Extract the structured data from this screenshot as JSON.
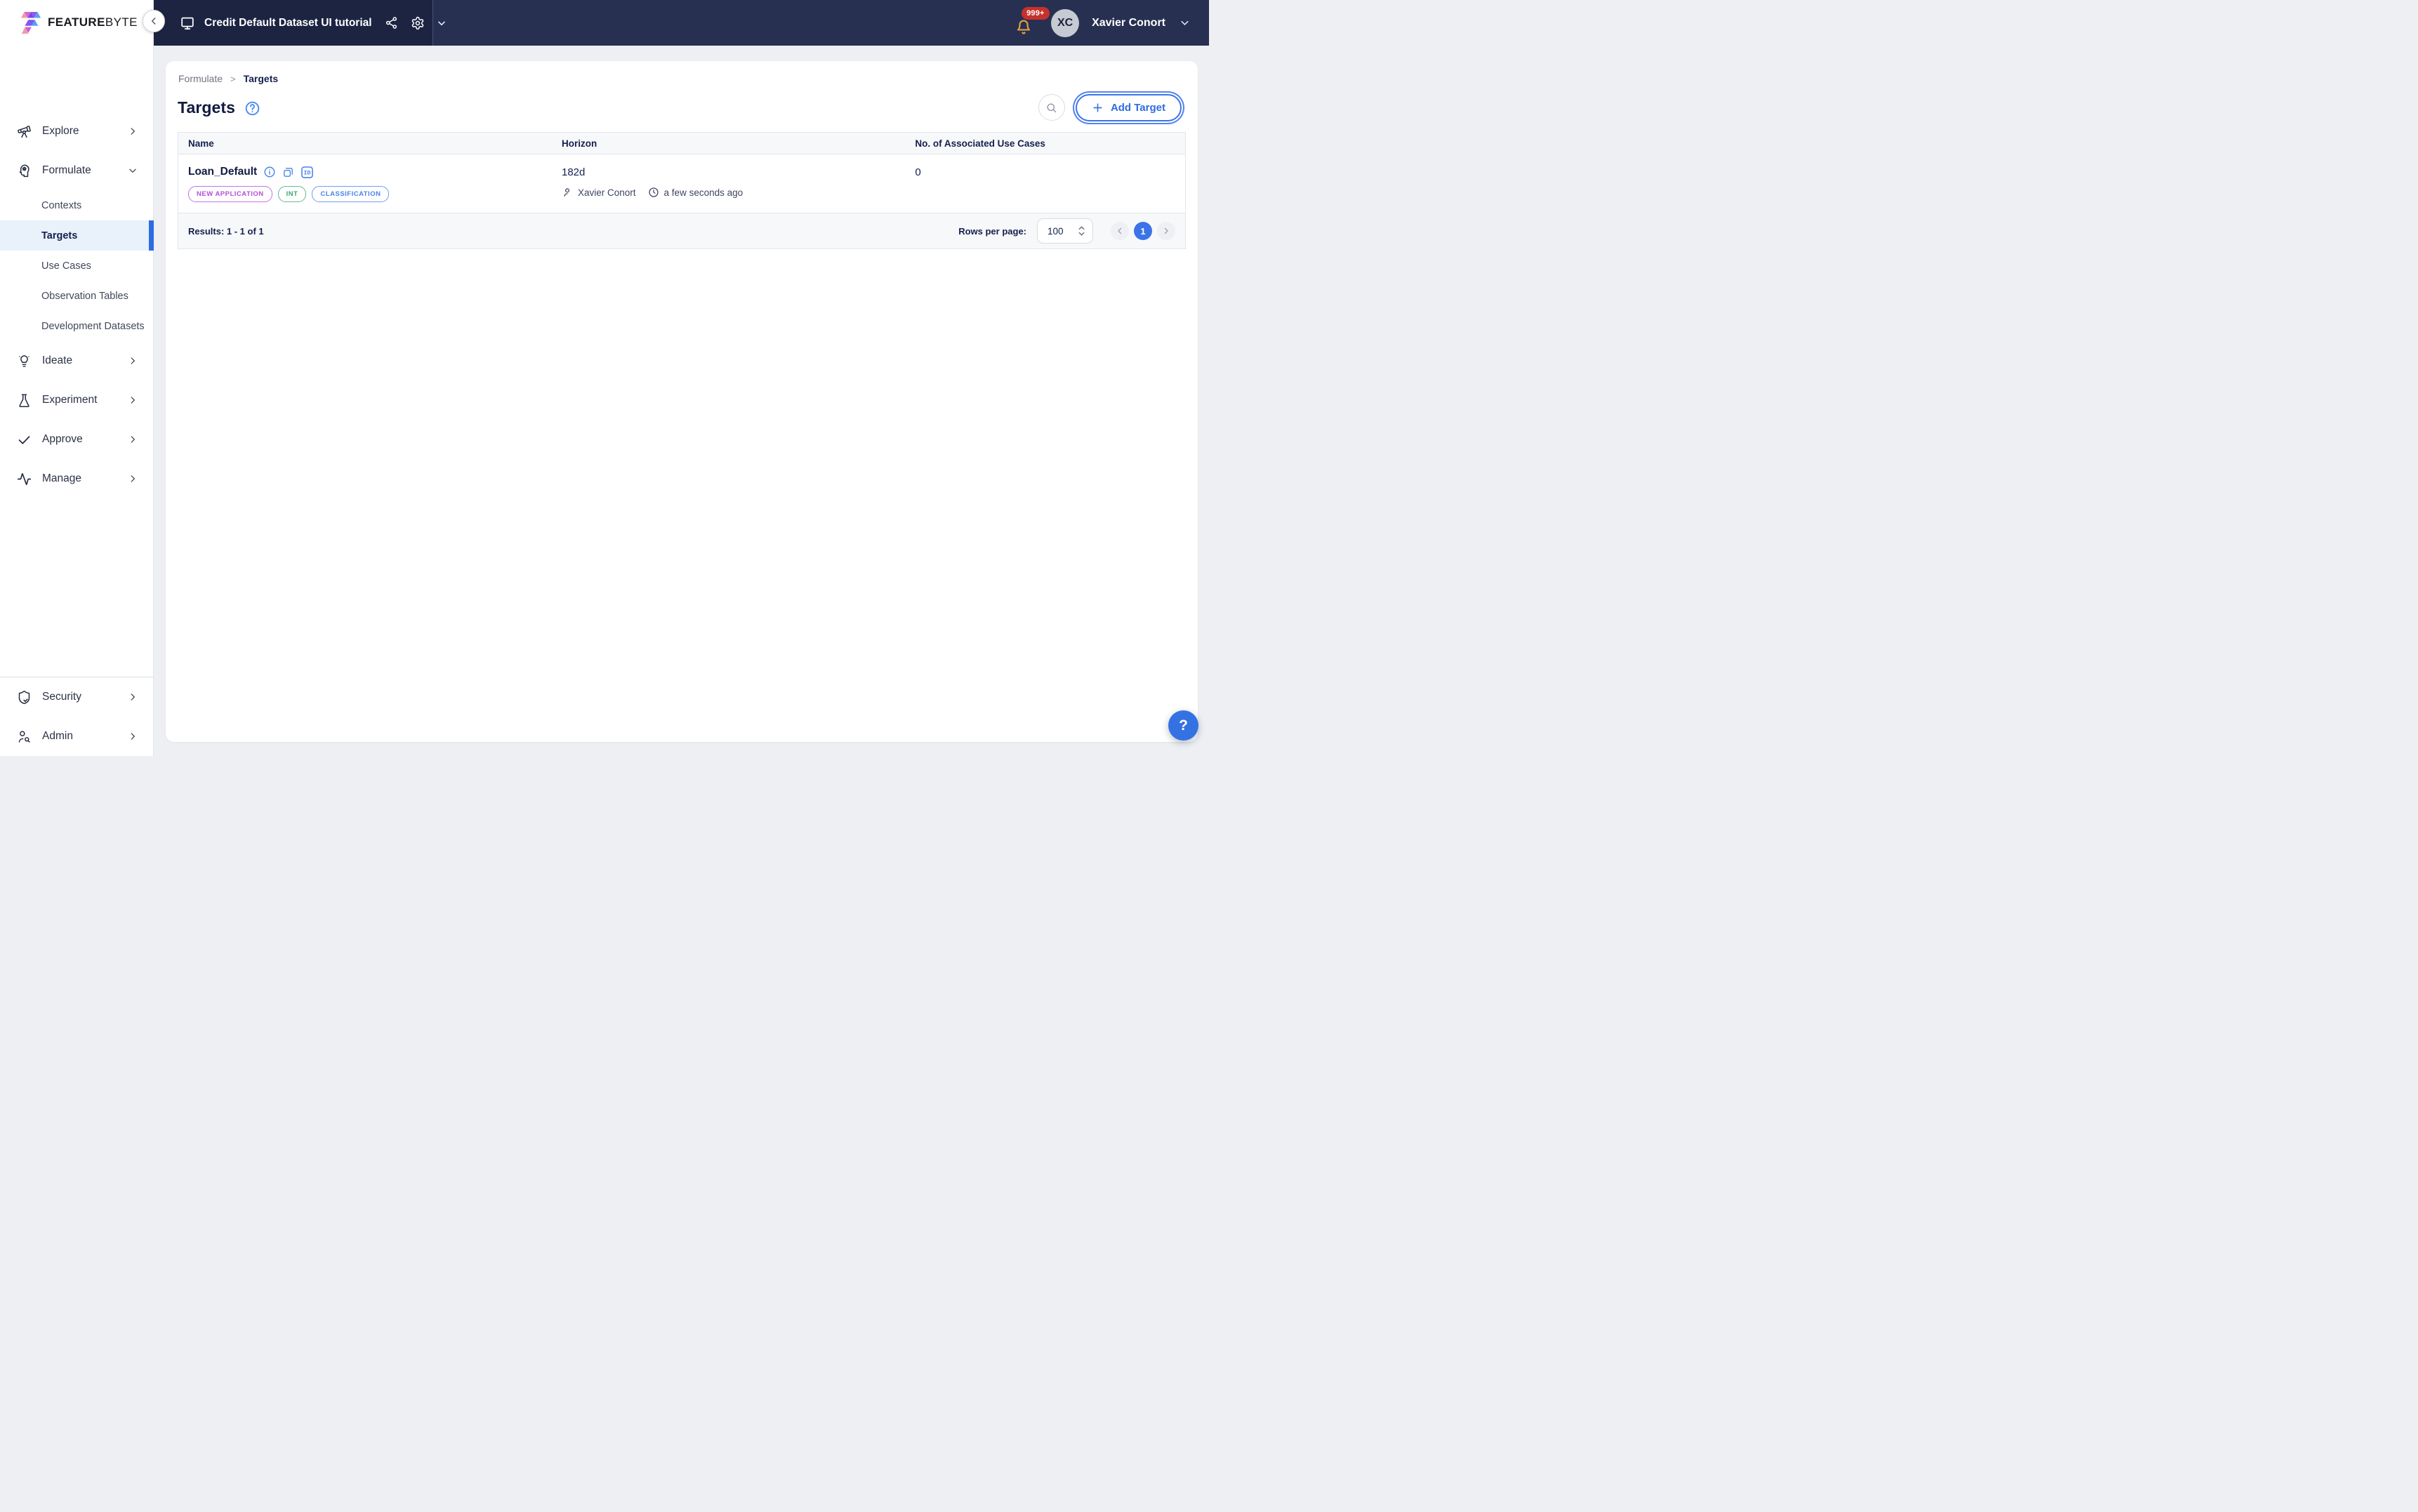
{
  "brand": {
    "bold": "FEATURE",
    "light": "BYTE"
  },
  "topbar": {
    "project_title": "Credit Default Dataset UI tutorial",
    "notifications_badge": "999+",
    "user_initials": "XC",
    "user_name": "Xavier Conort"
  },
  "sidebar": {
    "items": [
      {
        "label": "Explore",
        "icon": "telescope"
      },
      {
        "label": "Formulate",
        "icon": "head-cog",
        "expanded": true
      },
      {
        "label": "Contexts"
      },
      {
        "label": "Targets",
        "active": true
      },
      {
        "label": "Use Cases"
      },
      {
        "label": "Observation Tables"
      },
      {
        "label": "Development Datasets"
      },
      {
        "label": "Ideate",
        "icon": "lightbulb"
      },
      {
        "label": "Experiment",
        "icon": "flask"
      },
      {
        "label": "Approve",
        "icon": "check"
      },
      {
        "label": "Manage",
        "icon": "activity"
      },
      {
        "label": "Security",
        "icon": "shield-check"
      },
      {
        "label": "Admin",
        "icon": "user-search"
      }
    ]
  },
  "breadcrumb": {
    "parent": "Formulate",
    "separator": ">",
    "current": "Targets"
  },
  "page": {
    "title": "Targets"
  },
  "toolbar": {
    "add_button": "Add Target"
  },
  "table": {
    "columns": [
      "Name",
      "Horizon",
      "No. of Associated Use Cases"
    ],
    "rows": [
      {
        "name": "Loan_Default",
        "id_icon_label": "ID",
        "tags": [
          {
            "label": "NEW APPLICATION",
            "color": "#b44fd8"
          },
          {
            "label": "INT",
            "color": "#3fa873"
          },
          {
            "label": "CLASSIFICATION",
            "color": "#4a84e8"
          }
        ],
        "horizon": "182d",
        "author": "Xavier Conort",
        "updated": "a few seconds ago",
        "use_cases": "0"
      }
    ]
  },
  "footer": {
    "results": "Results: 1 - 1 of 1",
    "rows_per_page_label": "Rows per page:",
    "rows_per_page_value": "100",
    "current_page": "1"
  },
  "help_button": "?",
  "colors": {
    "accent_blue": "#3b74e8",
    "topbar_bg": "#283052",
    "topbar_project_bg": "#1d2442",
    "active_item_bg": "#e9f1fb",
    "badge_red": "#c5312c",
    "bell_amber": "#e8a33d",
    "tag_purple": "#b44fd8",
    "tag_green": "#3fa873",
    "tag_blue": "#4a84e8"
  }
}
